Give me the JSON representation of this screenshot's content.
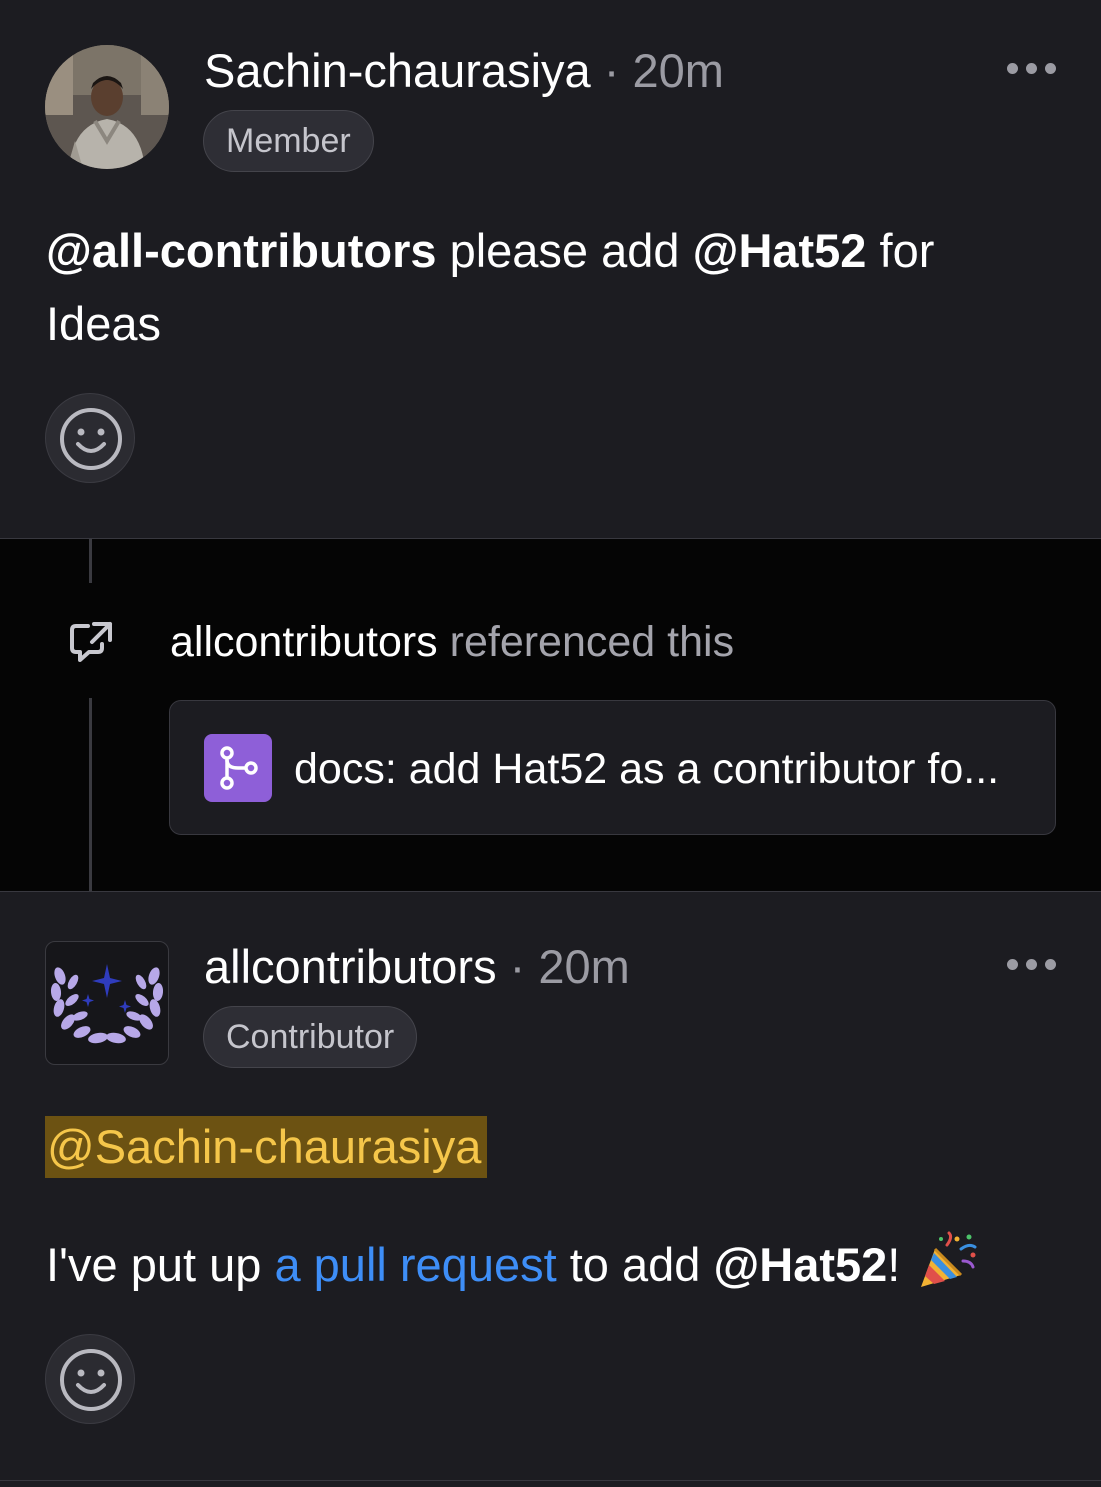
{
  "comments": [
    {
      "author": "Sachin-chaurasiya",
      "separator": "·",
      "time": "20m",
      "badge": "Member",
      "avatar_icon": "user-photo-avatar",
      "body": {
        "mention1": "@all-contributors",
        "text1": " please add ",
        "mention2": "@Hat52",
        "text2": " for Ideas"
      },
      "reaction_icon": "smiley-icon"
    },
    {
      "author": "allcontributors",
      "separator": "·",
      "time": "20m",
      "badge": "Contributor",
      "avatar_icon": "laurel-sparkle-logo",
      "mention": "@Sachin-chaurasiya",
      "body": {
        "text1": "I've put up ",
        "link": "a pull request",
        "text2": " to add ",
        "mention": "@Hat52",
        "text3": "! ",
        "emoji_icon": "party-popper-icon"
      },
      "reaction_icon": "smiley-icon"
    }
  ],
  "event": {
    "icon": "cross-reference-icon",
    "actor": "allcontributors",
    "action": " referenced this",
    "reference": {
      "icon": "pull-request-icon",
      "title": "docs: add Hat52 as a contributor fo..."
    }
  },
  "colors": {
    "background": "#1c1c21",
    "event_background": "#050505",
    "link": "#3e8ef7",
    "mention_highlight": "#6c5212",
    "mention_text": "#f5c64a",
    "pr_icon": "#8e5fd8"
  }
}
